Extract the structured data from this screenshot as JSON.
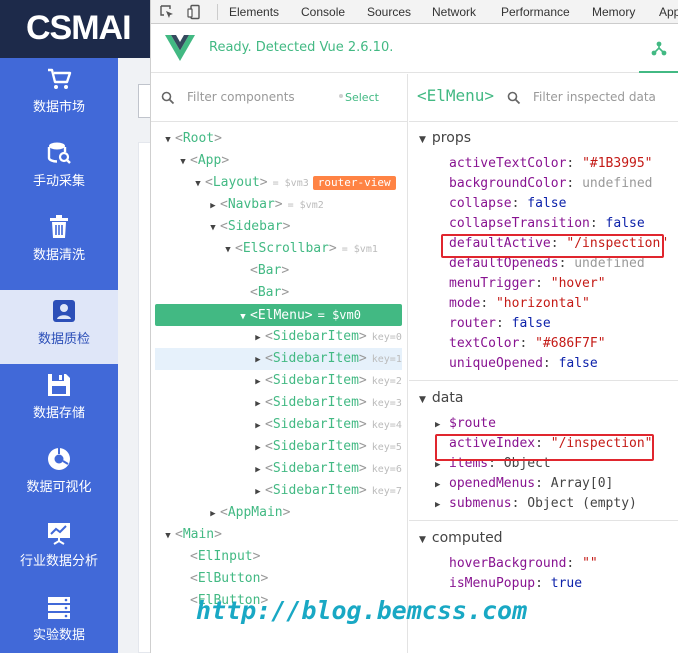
{
  "app": {
    "logo": "CSMAI",
    "sidebar": [
      {
        "label": "数据市场",
        "icon": "shopping-cart-icon"
      },
      {
        "label": "手动采集",
        "icon": "database-search-icon"
      },
      {
        "label": "数据清洗",
        "icon": "trash-icon"
      },
      {
        "label": "数据质检",
        "icon": "user-badge-icon",
        "active": true
      },
      {
        "label": "数据存储",
        "icon": "floppy-disk-icon"
      },
      {
        "label": "数据可视化",
        "icon": "pie-chart-icon"
      },
      {
        "label": "行业数据分析",
        "icon": "presentation-chart-icon"
      },
      {
        "label": "实验数据",
        "icon": "server-stack-icon"
      }
    ]
  },
  "devtools": {
    "tabs": [
      "Elements",
      "Console",
      "Sources",
      "Network",
      "Performance",
      "Memory",
      "App"
    ],
    "vue_status": "Ready. Detected Vue 2.6.10.",
    "filter_components_placeholder": "Filter components",
    "select_label": "Select",
    "inspected_component": "<ElMenu>",
    "filter_inspected_placeholder": "Filter inspected data"
  },
  "tree": [
    {
      "indent": 0,
      "arrow": "down",
      "name": "Root"
    },
    {
      "indent": 1,
      "arrow": "down",
      "name": "App"
    },
    {
      "indent": 2,
      "arrow": "down",
      "name": "Layout",
      "meta": "= $vm3",
      "badge": "router-view"
    },
    {
      "indent": 3,
      "arrow": "right",
      "name": "Navbar",
      "meta": "= $vm2"
    },
    {
      "indent": 3,
      "arrow": "down",
      "name": "Sidebar"
    },
    {
      "indent": 4,
      "arrow": "down",
      "name": "ElScrollbar",
      "meta": "= $vm1"
    },
    {
      "indent": 5,
      "arrow": "",
      "name": "Bar"
    },
    {
      "indent": 5,
      "arrow": "",
      "name": "Bar"
    },
    {
      "indent": 5,
      "arrow": "down",
      "name": "ElMenu",
      "meta": "= $vm0",
      "selected": true
    },
    {
      "indent": 6,
      "arrow": "right",
      "name": "SidebarItem",
      "meta": "key=0"
    },
    {
      "indent": 6,
      "arrow": "right",
      "name": "SidebarItem",
      "meta": "key=1",
      "hover": true
    },
    {
      "indent": 6,
      "arrow": "right",
      "name": "SidebarItem",
      "meta": "key=2"
    },
    {
      "indent": 6,
      "arrow": "right",
      "name": "SidebarItem",
      "meta": "key=3"
    },
    {
      "indent": 6,
      "arrow": "right",
      "name": "SidebarItem",
      "meta": "key=4"
    },
    {
      "indent": 6,
      "arrow": "right",
      "name": "SidebarItem",
      "meta": "key=5"
    },
    {
      "indent": 6,
      "arrow": "right",
      "name": "SidebarItem",
      "meta": "key=6"
    },
    {
      "indent": 6,
      "arrow": "right",
      "name": "SidebarItem",
      "meta": "key=7"
    },
    {
      "indent": 3,
      "arrow": "right",
      "name": "AppMain"
    },
    {
      "indent": 0,
      "arrow": "down",
      "name": "Main"
    },
    {
      "indent": 1,
      "arrow": "",
      "name": "ElInput"
    },
    {
      "indent": 1,
      "arrow": "",
      "name": "ElButton"
    },
    {
      "indent": 1,
      "arrow": "",
      "name": "ElButton"
    }
  ],
  "inspector": {
    "props_title": "props",
    "props": [
      {
        "key": "activeTextColor",
        "value": "\"#1B3995\"",
        "type": "s"
      },
      {
        "key": "backgroundColor",
        "value": "undefined",
        "type": "u"
      },
      {
        "key": "collapse",
        "value": "false",
        "type": "b"
      },
      {
        "key": "collapseTransition",
        "value": "false",
        "type": "b"
      },
      {
        "key": "defaultActive",
        "value": "\"/inspection\"",
        "type": "s",
        "highlight": true
      },
      {
        "key": "defaultOpeneds",
        "value": "undefined",
        "type": "u"
      },
      {
        "key": "menuTrigger",
        "value": "\"hover\"",
        "type": "s"
      },
      {
        "key": "mode",
        "value": "\"horizontal\"",
        "type": "s"
      },
      {
        "key": "router",
        "value": "false",
        "type": "b"
      },
      {
        "key": "textColor",
        "value": "\"#686F7F\"",
        "type": "s"
      },
      {
        "key": "uniqueOpened",
        "value": "false",
        "type": "b"
      }
    ],
    "data_title": "data",
    "data": [
      {
        "key": "$route",
        "value": "",
        "type": "o",
        "expandable": true
      },
      {
        "key": "activeIndex",
        "value": "\"/inspection\"",
        "type": "s",
        "highlight": true
      },
      {
        "key": "items",
        "value": "Object",
        "type": "o",
        "expandable": true
      },
      {
        "key": "openedMenus",
        "value": "Array[0]",
        "type": "o",
        "expandable": true
      },
      {
        "key": "submenus",
        "value": "Object (empty)",
        "type": "o",
        "expandable": true
      }
    ],
    "computed_title": "computed",
    "computed": [
      {
        "key": "hoverBackground",
        "value": "\"\"",
        "type": "s"
      },
      {
        "key": "isMenuPopup",
        "value": "true",
        "type": "b"
      }
    ]
  },
  "watermark": "http://blog.bemcss.com",
  "colors": {
    "vue_green": "#42b983",
    "sidebar_blue": "#4169d8",
    "header_navy": "#1d2a4a",
    "badge_orange": "#ff8344",
    "highlight_red": "#e0262e"
  }
}
